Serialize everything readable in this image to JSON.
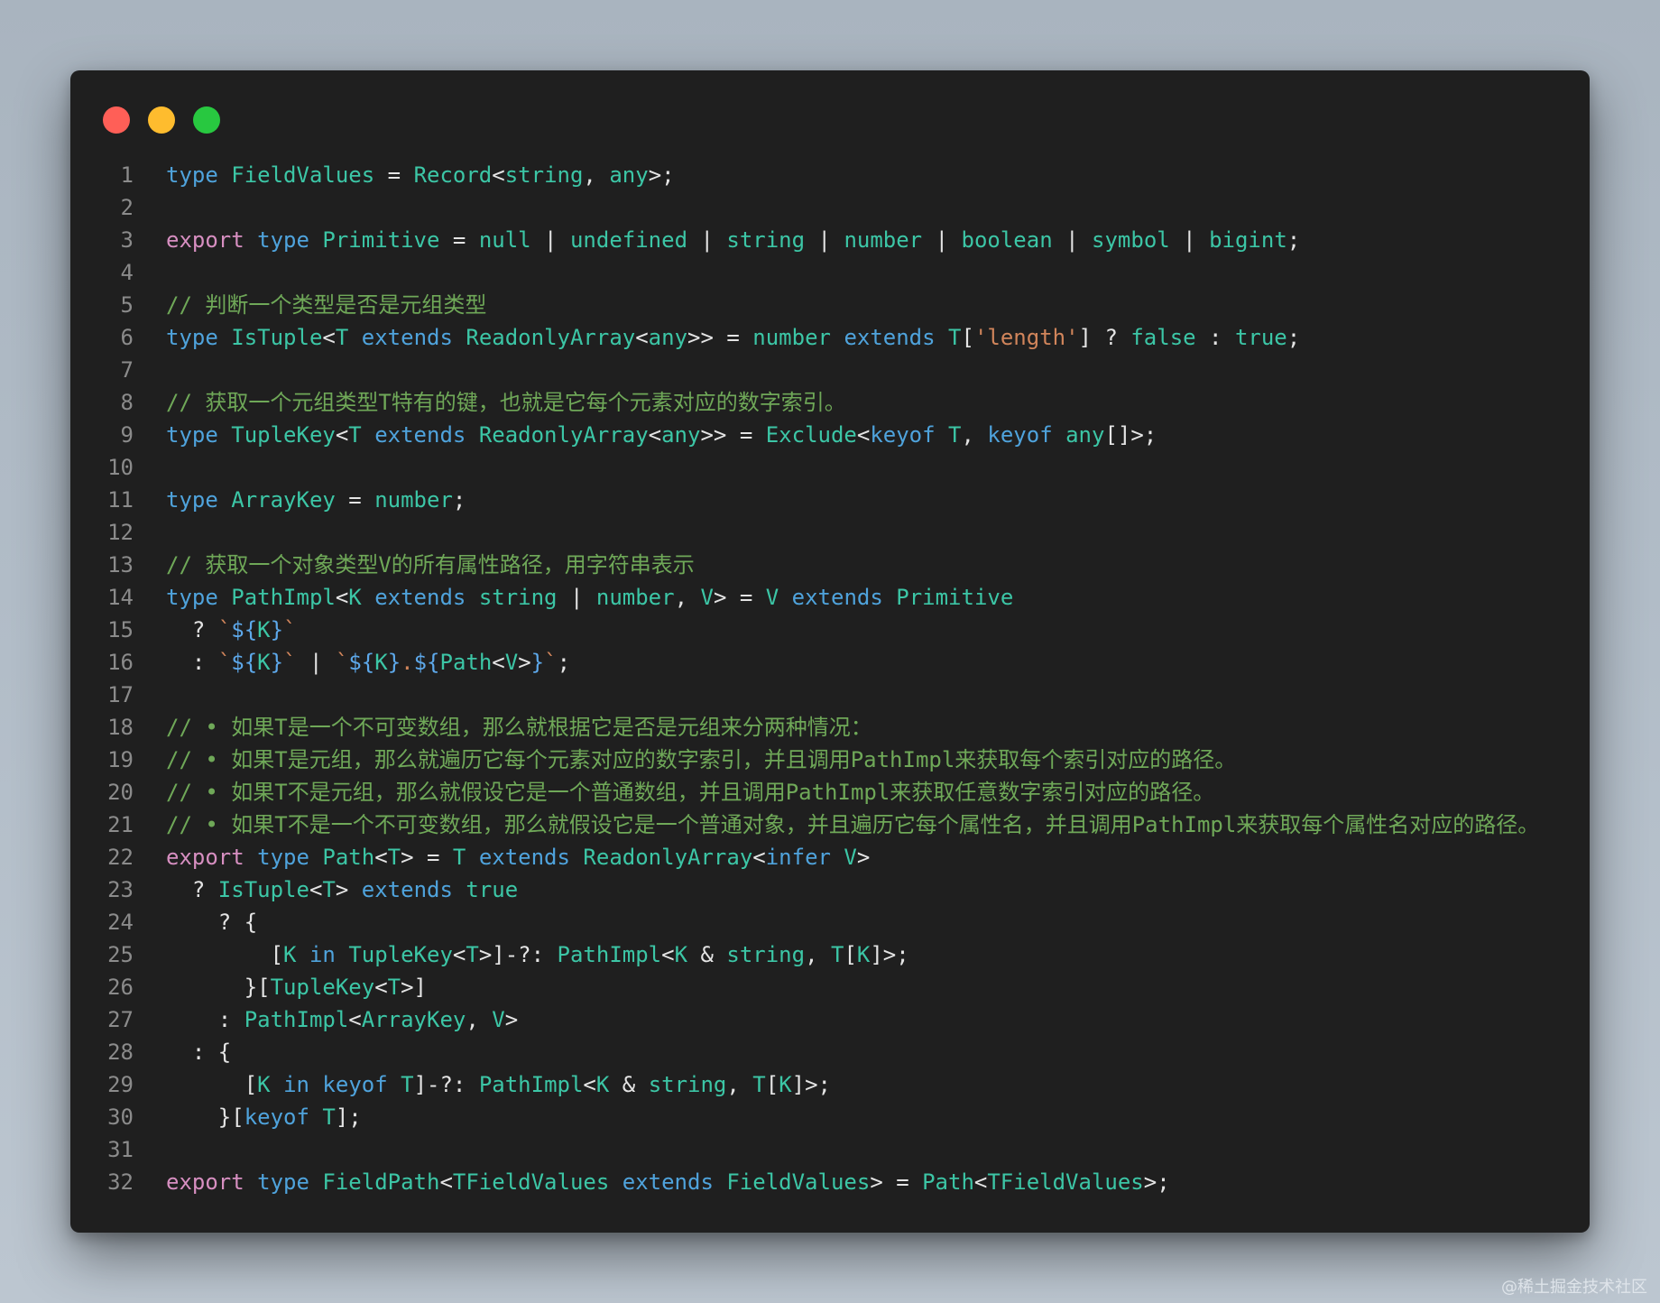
{
  "window": {
    "traffic_lights": [
      {
        "name": "close",
        "color": "#ff5f57"
      },
      {
        "name": "minimize",
        "color": "#febc2e"
      },
      {
        "name": "zoom",
        "color": "#28c840"
      }
    ]
  },
  "colors": {
    "keyword": "#4fa3dc",
    "export": "#d78fc1",
    "type": "#3cc6a6",
    "comment": "#6fa858",
    "string": "#d1855b",
    "punct": "#e4e4e4",
    "template": "#5da8ea",
    "line_number": "#8b8b8b"
  },
  "code": [
    {
      "n": "1",
      "tokens": [
        [
          "type",
          "kw"
        ],
        [
          " ",
          ""
        ],
        [
          "FieldValues",
          "ty"
        ],
        [
          " = ",
          "p"
        ],
        [
          "Record",
          "ty"
        ],
        [
          "<",
          "p"
        ],
        [
          "string",
          "ty"
        ],
        [
          ", ",
          "p"
        ],
        [
          "any",
          "ty"
        ],
        [
          ">;",
          "p"
        ]
      ]
    },
    {
      "n": "2",
      "tokens": []
    },
    {
      "n": "3",
      "tokens": [
        [
          "export",
          "ex"
        ],
        [
          " ",
          ""
        ],
        [
          "type",
          "kw"
        ],
        [
          " ",
          ""
        ],
        [
          "Primitive",
          "ty"
        ],
        [
          " = ",
          "p"
        ],
        [
          "null",
          "ty"
        ],
        [
          " | ",
          "p"
        ],
        [
          "undefined",
          "ty"
        ],
        [
          " | ",
          "p"
        ],
        [
          "string",
          "ty"
        ],
        [
          " | ",
          "p"
        ],
        [
          "number",
          "ty"
        ],
        [
          " | ",
          "p"
        ],
        [
          "boolean",
          "ty"
        ],
        [
          " | ",
          "p"
        ],
        [
          "symbol",
          "ty"
        ],
        [
          " | ",
          "p"
        ],
        [
          "bigint",
          "ty"
        ],
        [
          ";",
          "p"
        ]
      ]
    },
    {
      "n": "4",
      "tokens": []
    },
    {
      "n": "5",
      "tokens": [
        [
          "// 判断一个类型是否是元组类型",
          "cm"
        ]
      ]
    },
    {
      "n": "6",
      "tokens": [
        [
          "type",
          "kw"
        ],
        [
          " ",
          ""
        ],
        [
          "IsTuple",
          "ty"
        ],
        [
          "<",
          "p"
        ],
        [
          "T",
          "ty"
        ],
        [
          " ",
          ""
        ],
        [
          "extends",
          "kw"
        ],
        [
          " ",
          ""
        ],
        [
          "ReadonlyArray",
          "ty"
        ],
        [
          "<",
          "p"
        ],
        [
          "any",
          "ty"
        ],
        [
          ">> = ",
          "p"
        ],
        [
          "number",
          "ty"
        ],
        [
          " ",
          ""
        ],
        [
          "extends",
          "kw"
        ],
        [
          " ",
          ""
        ],
        [
          "T",
          "ty"
        ],
        [
          "[",
          "p"
        ],
        [
          "'length'",
          "st"
        ],
        [
          "] ? ",
          "p"
        ],
        [
          "false",
          "ty"
        ],
        [
          " : ",
          "p"
        ],
        [
          "true",
          "ty"
        ],
        [
          ";",
          "p"
        ]
      ]
    },
    {
      "n": "7",
      "tokens": []
    },
    {
      "n": "8",
      "tokens": [
        [
          "// 获取一个元组类型T特有的键，也就是它每个元素对应的数字索引。",
          "cm"
        ]
      ]
    },
    {
      "n": "9",
      "tokens": [
        [
          "type",
          "kw"
        ],
        [
          " ",
          ""
        ],
        [
          "TupleKey",
          "ty"
        ],
        [
          "<",
          "p"
        ],
        [
          "T",
          "ty"
        ],
        [
          " ",
          ""
        ],
        [
          "extends",
          "kw"
        ],
        [
          " ",
          ""
        ],
        [
          "ReadonlyArray",
          "ty"
        ],
        [
          "<",
          "p"
        ],
        [
          "any",
          "ty"
        ],
        [
          ">> = ",
          "p"
        ],
        [
          "Exclude",
          "ty"
        ],
        [
          "<",
          "p"
        ],
        [
          "keyof",
          "kw"
        ],
        [
          " ",
          ""
        ],
        [
          "T",
          "ty"
        ],
        [
          ", ",
          "p"
        ],
        [
          "keyof",
          "kw"
        ],
        [
          " ",
          ""
        ],
        [
          "any",
          "ty"
        ],
        [
          "[]>;",
          "p"
        ]
      ]
    },
    {
      "n": "10",
      "tokens": []
    },
    {
      "n": "11",
      "tokens": [
        [
          "type",
          "kw"
        ],
        [
          " ",
          ""
        ],
        [
          "ArrayKey",
          "ty"
        ],
        [
          " = ",
          "p"
        ],
        [
          "number",
          "ty"
        ],
        [
          ";",
          "p"
        ]
      ]
    },
    {
      "n": "12",
      "tokens": []
    },
    {
      "n": "13",
      "tokens": [
        [
          "// 获取一个对象类型V的所有属性路径，用字符串表示",
          "cm"
        ]
      ]
    },
    {
      "n": "14",
      "tokens": [
        [
          "type",
          "kw"
        ],
        [
          " ",
          ""
        ],
        [
          "PathImpl",
          "ty"
        ],
        [
          "<",
          "p"
        ],
        [
          "K",
          "ty"
        ],
        [
          " ",
          ""
        ],
        [
          "extends",
          "kw"
        ],
        [
          " ",
          ""
        ],
        [
          "string",
          "ty"
        ],
        [
          " | ",
          "p"
        ],
        [
          "number",
          "ty"
        ],
        [
          ", ",
          "p"
        ],
        [
          "V",
          "ty"
        ],
        [
          "> = ",
          "p"
        ],
        [
          "V",
          "ty"
        ],
        [
          " ",
          ""
        ],
        [
          "extends",
          "kw"
        ],
        [
          " ",
          ""
        ],
        [
          "Primitive",
          "ty"
        ]
      ]
    },
    {
      "n": "15",
      "tokens": [
        [
          "  ? ",
          "p"
        ],
        [
          "`",
          "st"
        ],
        [
          "${",
          "tp"
        ],
        [
          "K",
          "ty"
        ],
        [
          "}",
          "tp"
        ],
        [
          "`",
          "st"
        ]
      ]
    },
    {
      "n": "16",
      "tokens": [
        [
          "  : ",
          "p"
        ],
        [
          "`",
          "st"
        ],
        [
          "${",
          "tp"
        ],
        [
          "K",
          "ty"
        ],
        [
          "}",
          "tp"
        ],
        [
          "`",
          "st"
        ],
        [
          " | ",
          "p"
        ],
        [
          "`",
          "st"
        ],
        [
          "${",
          "tp"
        ],
        [
          "K",
          "ty"
        ],
        [
          "}",
          "tp"
        ],
        [
          ".",
          "st"
        ],
        [
          "${",
          "tp"
        ],
        [
          "Path",
          "ty"
        ],
        [
          "<",
          "p"
        ],
        [
          "V",
          "ty"
        ],
        [
          ">",
          "p"
        ],
        [
          "}",
          "tp"
        ],
        [
          "`",
          "st"
        ],
        [
          ";",
          "p"
        ]
      ]
    },
    {
      "n": "17",
      "tokens": []
    },
    {
      "n": "18",
      "tokens": [
        [
          "// • 如果T是一个不可变数组，那么就根据它是否是元组来分两种情况：",
          "cm"
        ]
      ]
    },
    {
      "n": "19",
      "tokens": [
        [
          "// • 如果T是元组，那么就遍历它每个元素对应的数字索引，并且调用PathImpl来获取每个索引对应的路径。",
          "cm"
        ]
      ]
    },
    {
      "n": "20",
      "tokens": [
        [
          "// • 如果T不是元组，那么就假设它是一个普通数组，并且调用PathImpl来获取任意数字索引对应的路径。",
          "cm"
        ]
      ]
    },
    {
      "n": "21",
      "tokens": [
        [
          "// • 如果T不是一个不可变数组，那么就假设它是一个普通对象，并且遍历它每个属性名，并且调用PathImpl来获取每个属性名对应的路径。",
          "cm"
        ]
      ]
    },
    {
      "n": "22",
      "tokens": [
        [
          "export",
          "ex"
        ],
        [
          " ",
          ""
        ],
        [
          "type",
          "kw"
        ],
        [
          " ",
          ""
        ],
        [
          "Path",
          "ty"
        ],
        [
          "<",
          "p"
        ],
        [
          "T",
          "ty"
        ],
        [
          "> = ",
          "p"
        ],
        [
          "T",
          "ty"
        ],
        [
          " ",
          ""
        ],
        [
          "extends",
          "kw"
        ],
        [
          " ",
          ""
        ],
        [
          "ReadonlyArray",
          "ty"
        ],
        [
          "<",
          "p"
        ],
        [
          "infer",
          "kw"
        ],
        [
          " ",
          ""
        ],
        [
          "V",
          "ty"
        ],
        [
          ">",
          "p"
        ]
      ]
    },
    {
      "n": "23",
      "tokens": [
        [
          "  ? ",
          "p"
        ],
        [
          "IsTuple",
          "ty"
        ],
        [
          "<",
          "p"
        ],
        [
          "T",
          "ty"
        ],
        [
          "> ",
          "p"
        ],
        [
          "extends",
          "kw"
        ],
        [
          " ",
          ""
        ],
        [
          "true",
          "ty"
        ]
      ]
    },
    {
      "n": "24",
      "tokens": [
        [
          "    ? {",
          "p"
        ]
      ]
    },
    {
      "n": "25",
      "tokens": [
        [
          "        [",
          "p"
        ],
        [
          "K",
          "ty"
        ],
        [
          " ",
          ""
        ],
        [
          "in",
          "kw"
        ],
        [
          " ",
          ""
        ],
        [
          "TupleKey",
          "ty"
        ],
        [
          "<",
          "p"
        ],
        [
          "T",
          "ty"
        ],
        [
          ">]-?: ",
          "p"
        ],
        [
          "PathImpl",
          "ty"
        ],
        [
          "<",
          "p"
        ],
        [
          "K",
          "ty"
        ],
        [
          " & ",
          "p"
        ],
        [
          "string",
          "ty"
        ],
        [
          ", ",
          "p"
        ],
        [
          "T",
          "ty"
        ],
        [
          "[",
          "p"
        ],
        [
          "K",
          "ty"
        ],
        [
          "]>;",
          "p"
        ]
      ]
    },
    {
      "n": "26",
      "tokens": [
        [
          "      }[",
          "p"
        ],
        [
          "TupleKey",
          "ty"
        ],
        [
          "<",
          "p"
        ],
        [
          "T",
          "ty"
        ],
        [
          ">]",
          "p"
        ]
      ]
    },
    {
      "n": "27",
      "tokens": [
        [
          "    : ",
          "p"
        ],
        [
          "PathImpl",
          "ty"
        ],
        [
          "<",
          "p"
        ],
        [
          "ArrayKey",
          "ty"
        ],
        [
          ", ",
          "p"
        ],
        [
          "V",
          "ty"
        ],
        [
          ">",
          "p"
        ]
      ]
    },
    {
      "n": "28",
      "tokens": [
        [
          "  : {",
          "p"
        ]
      ]
    },
    {
      "n": "29",
      "tokens": [
        [
          "      [",
          "p"
        ],
        [
          "K",
          "ty"
        ],
        [
          " ",
          ""
        ],
        [
          "in",
          "kw"
        ],
        [
          " ",
          ""
        ],
        [
          "keyof",
          "kw"
        ],
        [
          " ",
          ""
        ],
        [
          "T",
          "ty"
        ],
        [
          "]-?: ",
          "p"
        ],
        [
          "PathImpl",
          "ty"
        ],
        [
          "<",
          "p"
        ],
        [
          "K",
          "ty"
        ],
        [
          " & ",
          "p"
        ],
        [
          "string",
          "ty"
        ],
        [
          ", ",
          "p"
        ],
        [
          "T",
          "ty"
        ],
        [
          "[",
          "p"
        ],
        [
          "K",
          "ty"
        ],
        [
          "]>;",
          "p"
        ]
      ]
    },
    {
      "n": "30",
      "tokens": [
        [
          "    }[",
          "p"
        ],
        [
          "keyof",
          "kw"
        ],
        [
          " ",
          ""
        ],
        [
          "T",
          "ty"
        ],
        [
          "];",
          "p"
        ]
      ]
    },
    {
      "n": "31",
      "tokens": []
    },
    {
      "n": "32",
      "tokens": [
        [
          "export",
          "ex"
        ],
        [
          " ",
          ""
        ],
        [
          "type",
          "kw"
        ],
        [
          " ",
          ""
        ],
        [
          "FieldPath",
          "ty"
        ],
        [
          "<",
          "p"
        ],
        [
          "TFieldValues",
          "ty"
        ],
        [
          " ",
          ""
        ],
        [
          "extends",
          "kw"
        ],
        [
          " ",
          ""
        ],
        [
          "FieldValues",
          "ty"
        ],
        [
          "> = ",
          "p"
        ],
        [
          "Path",
          "ty"
        ],
        [
          "<",
          "p"
        ],
        [
          "TFieldValues",
          "ty"
        ],
        [
          ">;",
          "p"
        ]
      ]
    }
  ],
  "watermark": "@稀土掘金技术社区"
}
